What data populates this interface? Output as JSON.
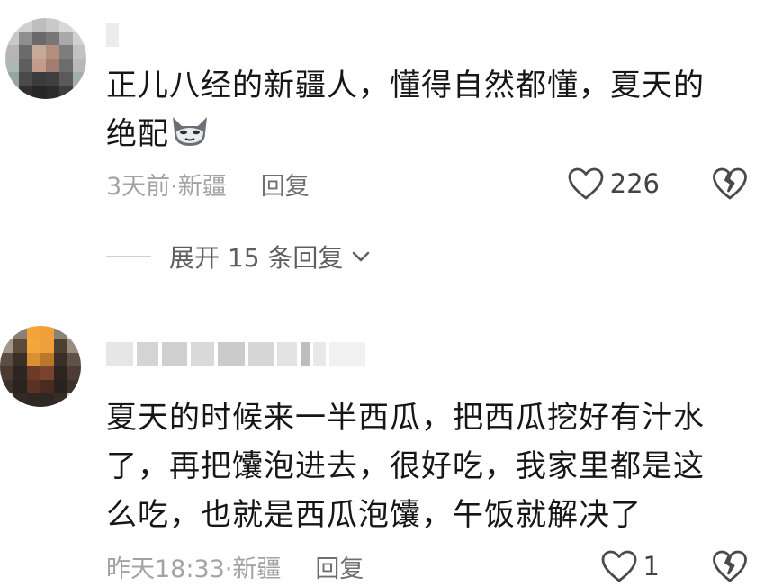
{
  "comments": [
    {
      "text_line1": "正儿八经的新疆人，懂得自然都懂，夏天的",
      "text_line2": "绝配",
      "emoji": "cat-face-icon",
      "time_location": "3天前·新疆",
      "reply_label": "回复",
      "like_count": "226"
    },
    {
      "text_line1": "夏天的时候来一半西瓜，把西瓜挖好有汁水",
      "text_line2": "了，再把馕泡进去，很好吃，我家里都是这",
      "text_line3": "么吃，也就是西瓜泡馕，午饭就解决了",
      "time_location": "昨天18:33·新疆",
      "reply_label": "回复",
      "like_count": "1"
    }
  ],
  "expand_replies": "展开 15 条回复",
  "icons": {
    "like": "heart-outline-icon",
    "dislike": "broken-heart-icon",
    "expand": "chevron-down-icon"
  },
  "colors": {
    "text": "#161616",
    "meta": "#9a9a9a",
    "reply": "#6f6f6f",
    "icon": "#4a4a4a"
  }
}
